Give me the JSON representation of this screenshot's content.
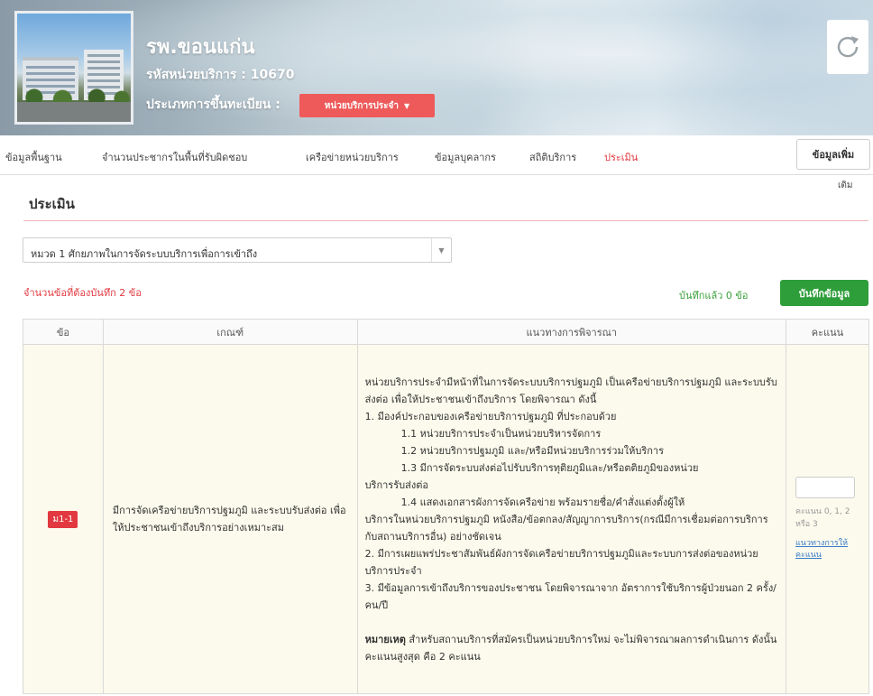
{
  "header": {
    "hospital_name": "รพ.ขอนแก่น",
    "service_code": "รหัสหน่วยบริการ : 10670",
    "registration_label": "ประเภทการขึ้นทะเบียน :",
    "registration_value": "หน่วยบริการประจำ",
    "refresh_icon": "refresh-icon"
  },
  "nav": {
    "items": [
      {
        "label": "ข้อมูลพื้นฐาน",
        "active": false
      },
      {
        "label": "จำนวนประชากรในพื้นที่รับผิดชอบ",
        "active": false
      },
      {
        "label": "เครือข่ายหน่วยบริการ",
        "active": false
      },
      {
        "label": "ข้อมูลบุคลากร",
        "active": false
      },
      {
        "label": "สถิติบริการ",
        "active": false
      },
      {
        "label": "ประเมิน",
        "active": true
      }
    ],
    "more_label": "ข้อมูลเพิ่ม",
    "more_label_wrap": "เติม"
  },
  "section": {
    "title": "ประเมิน",
    "category_selected": "หมวด 1 ศักยภาพในการจัดระบบบริการเพื่อการเข้าถึง",
    "required_count": "จำนวนข้อที่ต้องบันทึก 2 ข้อ",
    "saved_count": "บันทึกแล้ว 0 ข้อ",
    "save_button": "บันทึกข้อมูล"
  },
  "table": {
    "headers": [
      "ข้อ",
      "เกณฑ์",
      "แนวทางการพิจารณา",
      "คะแนน"
    ],
    "rows": [
      {
        "item_no": "ม1-1",
        "criterion": "มีการจัดเครือข่ายบริการปฐมภูมิ และระบบรับส่งต่อ เพื่อให้ประชาชนเข้าถึงบริการอย่างเหมาะสม",
        "guide": {
          "intro": "หน่วยบริการประจำมีหน้าที่ในการจัดระบบบริการปฐมภูมิ เป็นเครือข่ายบริการปฐมภูมิ และระบบรับส่งต่อ เพื่อให้ประชาชนเข้าถึงบริการ โดยพิจารณา ดังนี้",
          "p1": "1. มีองค์ประกอบของเครือข่ายบริการปฐมภูมิ ที่ประกอบด้วย",
          "p1_1": "1.1 หน่วยบริการประจำเป็นหน่วยบริหารจัดการ",
          "p1_2": "1.2 หน่วยบริการปฐมภูมิ และ/หรือมีหน่วยบริการร่วมให้บริการ",
          "p1_3a": "1.3 มีการจัดระบบส่งต่อไปรับบริการทุติยภูมิและ/หรือตติยภูมิของหน่วย",
          "p1_3b": "บริการรับส่งต่อ",
          "p1_4a": "1.4 แสดงเอกสารผังการจัดเครือข่าย พร้อมรายชื่อ/คำสั่งแต่งตั้งผู้ให้",
          "p1_4b": "บริการในหน่วยบริการปฐมภูมิ หนังสือ/ข้อตกลง/สัญญาการบริการ(กรณีมีการเชื่อมต่อการบริการกับสถานบริการอื่น) อย่างชัดเจน",
          "p2": "2. มีการเผยแพร่ประชาสัมพันธ์ผังการจัดเครือข่ายบริการปฐมภูมิและระบบการส่งต่อของหน่วยบริการประจำ",
          "p3": "3. มีข้อมูลการเข้าถึงบริการของประชาชน โดยพิจารณาจาก อัตราการใช้บริการผู้ป่วยนอก 2 ครั้ง/คน/ปี",
          "note_label": "หมายเหตุ",
          "note_text": " สำหรับสถานบริการที่สมัครเป็นหน่วยบริการใหม่ จะไม่พิจารณาผลการดำเนินการ ดังนั้นคะแนนสูงสุด คือ 2 คะแนน"
        },
        "score_value": "",
        "score_hint": "คะแนน 0, 1, 2 หรือ 3",
        "score_link": "แนวทางการให้คะแนน"
      }
    ]
  },
  "colors": {
    "accent_red": "#e2383f",
    "save_green": "#2e9e3a",
    "saved_text_green": "#3aa13a",
    "row_bg": "#fbfaec"
  }
}
